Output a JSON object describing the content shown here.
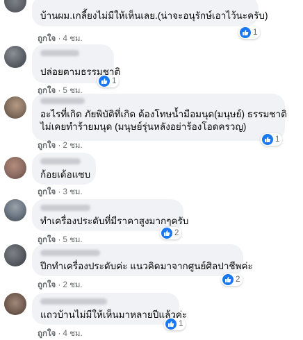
{
  "comments": [
    {
      "text": "บ้านผม.เกลี้ยงไม่มีให้เห็นเลย.(น่าจะอนุรักษ์เอาไว้นะครับ)",
      "like_label": "ถูกใจ",
      "time": "4 ชม.",
      "reactions": "1",
      "reaction_icon": "like-icon"
    },
    {
      "text": "ปล่อยตามธรรมชาติ",
      "like_label": "ถูกใจ",
      "time": "5 ชม.",
      "reactions": "1",
      "reaction_icon": "like-icon"
    },
    {
      "text_line1": "อะไรที่เกิด ภัยพิบัติที่เกิด ต้องโทษน้ำมือมนุด(มนุษย์) ธรรมชาติ",
      "text_line2": "ไม่เคยทำร้ายมนุด (มนุษย์รุ่นหลังอย่าร้องโอดครวญ)",
      "like_label": "ถูกใจ",
      "time": "2 ชม.",
      "reactions": "1",
      "reaction_icon": "like-icon"
    },
    {
      "text": "ก้อยเด้อแซบ",
      "like_label": "ถูกใจ",
      "time": "3 ชม."
    },
    {
      "text": "ทำเครื่องประดับที่มีราคาสูงมากๆครับ",
      "like_label": "ถูกใจ",
      "time": "5 ชม.",
      "reactions": "2",
      "reaction_icon": "like-icon"
    },
    {
      "text": "ปีกทำเครื่องประดับค่ะ แนวคิดมาจากศูนย์ศิลปาชีพค่ะ",
      "like_label": "ถูกใจ",
      "time": "2 ชม.",
      "reactions": "2",
      "reaction_icon": "like-icon"
    },
    {
      "text": "แถวบ้านไม่มีให้เห็นมาหลายปีแล้วค่ะ",
      "like_label": "ถูกใจ",
      "time": "4 ชม.",
      "reactions": "1",
      "reaction_icon": "like-icon"
    }
  ],
  "separator": "·",
  "colors": {
    "bubble": "#f0f2f5",
    "meta": "#65676b",
    "like_blue": "#1877f2"
  }
}
